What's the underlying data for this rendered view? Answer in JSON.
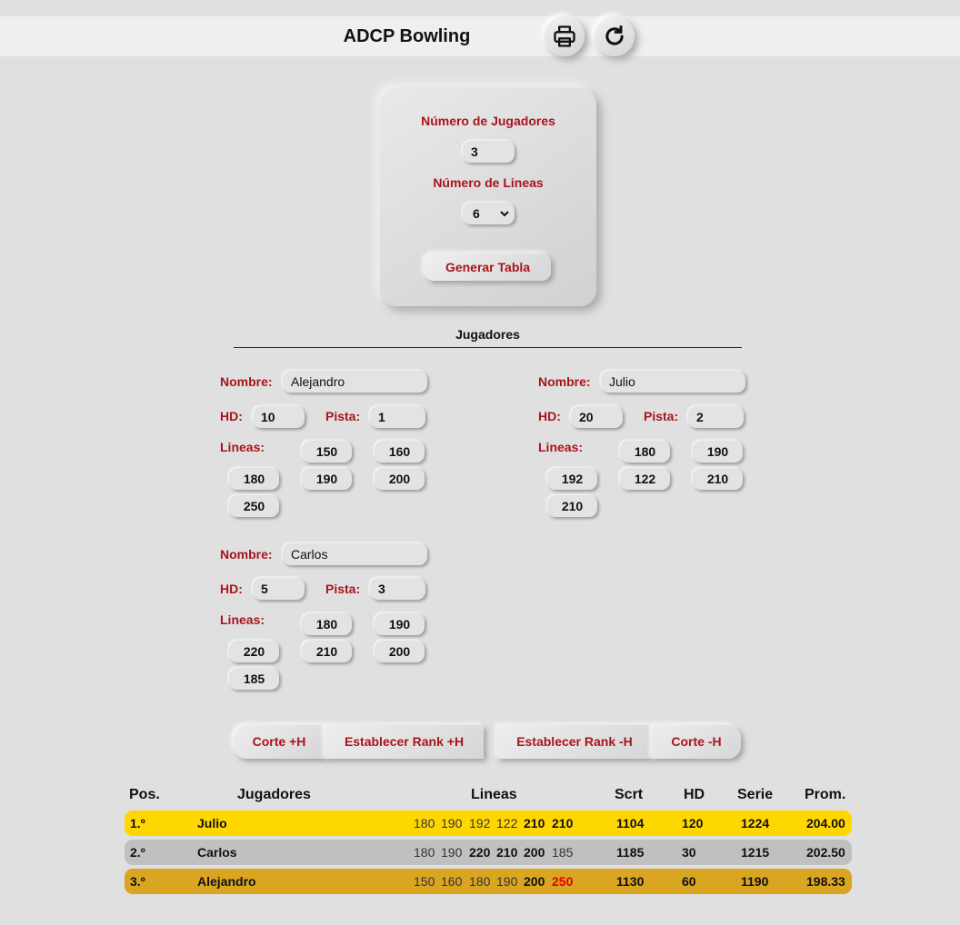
{
  "header": {
    "title": "ADCP Bowling",
    "print_icon": "printer-icon",
    "refresh_icon": "refresh-icon"
  },
  "setup": {
    "players_label": "Número de Jugadores",
    "players_value": "3",
    "lines_label": "Número de Lineas",
    "lines_value": "6",
    "generate_label": "Generar Tabla"
  },
  "players_section": {
    "title": "Jugadores"
  },
  "player_labels": {
    "name": "Nombre:",
    "hd": "HD:",
    "lane": "Pista:",
    "lines": "Lineas:"
  },
  "players": [
    {
      "name": "Alejandro",
      "hd": "10",
      "lane": "1",
      "lines": [
        "150",
        "160",
        "180",
        "190",
        "200",
        "250"
      ]
    },
    {
      "name": "Julio",
      "hd": "20",
      "lane": "2",
      "lines": [
        "180",
        "190",
        "192",
        "122",
        "210",
        "210"
      ]
    },
    {
      "name": "Carlos",
      "hd": "5",
      "lane": "3",
      "lines": [
        "180",
        "190",
        "220",
        "210",
        "200",
        "185"
      ]
    }
  ],
  "actions": {
    "cut_plus": "Corte +H",
    "rank_plus": "Establecer Rank +H",
    "rank_minus": "Establecer Rank -H",
    "cut_minus": "Corte -H"
  },
  "table": {
    "headers": {
      "pos": "Pos.",
      "players": "Jugadores",
      "lines": "Lineas",
      "scrt": "Scrt",
      "hd": "HD",
      "serie": "Serie",
      "avg": "Prom."
    },
    "rows": [
      {
        "pos": "1.º",
        "name": "Julio",
        "lines": [
          "180",
          "190",
          "192",
          "122",
          "210",
          "210"
        ],
        "scrt": "1104",
        "hd": "120",
        "serie": "1224",
        "avg": "204.00",
        "color": "#ffd700"
      },
      {
        "pos": "2.º",
        "name": "Carlos",
        "lines": [
          "180",
          "190",
          "220",
          "210",
          "200",
          "185"
        ],
        "scrt": "1185",
        "hd": "30",
        "serie": "1215",
        "avg": "202.50",
        "color": "#c0c0c0"
      },
      {
        "pos": "3.º",
        "name": "Alejandro",
        "lines": [
          "150",
          "160",
          "180",
          "190",
          "200",
          "250"
        ],
        "scrt": "1130",
        "hd": "60",
        "serie": "1190",
        "avg": "198.33",
        "color": "#daa520"
      }
    ]
  }
}
